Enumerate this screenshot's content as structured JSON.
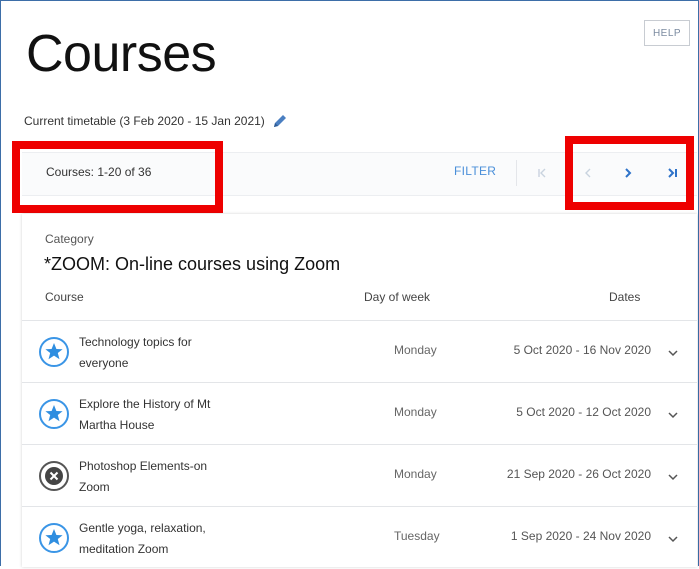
{
  "header": {
    "title": "Courses",
    "help_label": "HELP",
    "timetable": "Current timetable (3 Feb 2020 - 15 Jan 2021)"
  },
  "toolbar": {
    "count": "Courses: 1-20 of 36",
    "filter_label": "FILTER",
    "first_icon": "first-page-icon",
    "prev_icon": "chevron-left-icon",
    "next_icon": "chevron-right-icon",
    "last_icon": "last-page-icon"
  },
  "category": {
    "label": "Category",
    "name": "*ZOOM: On-line courses using Zoom"
  },
  "columns": {
    "course": "Course",
    "day": "Day of week",
    "dates": "Dates"
  },
  "courses": [
    {
      "title": "Technology topics for everyone",
      "day": "Monday",
      "dates": "5 Oct 2020 - 16 Nov 2020",
      "status_icon": "star-icon"
    },
    {
      "title": "Explore the History of Mt Martha House",
      "day": "Monday",
      "dates": "5 Oct 2020 - 12 Oct 2020",
      "status_icon": "star-icon"
    },
    {
      "title": "Photoshop Elements-on Zoom",
      "day": "Monday",
      "dates": "21 Sep 2020 - 26 Oct 2020",
      "status_icon": "cancelled-icon"
    },
    {
      "title": "Gentle yoga, relaxation, meditation Zoom",
      "day": "Tuesday",
      "dates": "1 Sep 2020 - 24 Nov 2020",
      "status_icon": "star-icon"
    }
  ],
  "colors": {
    "accent": "#2f8ee0",
    "highlight": "#ee0000",
    "frame": "#3d6ea8"
  }
}
